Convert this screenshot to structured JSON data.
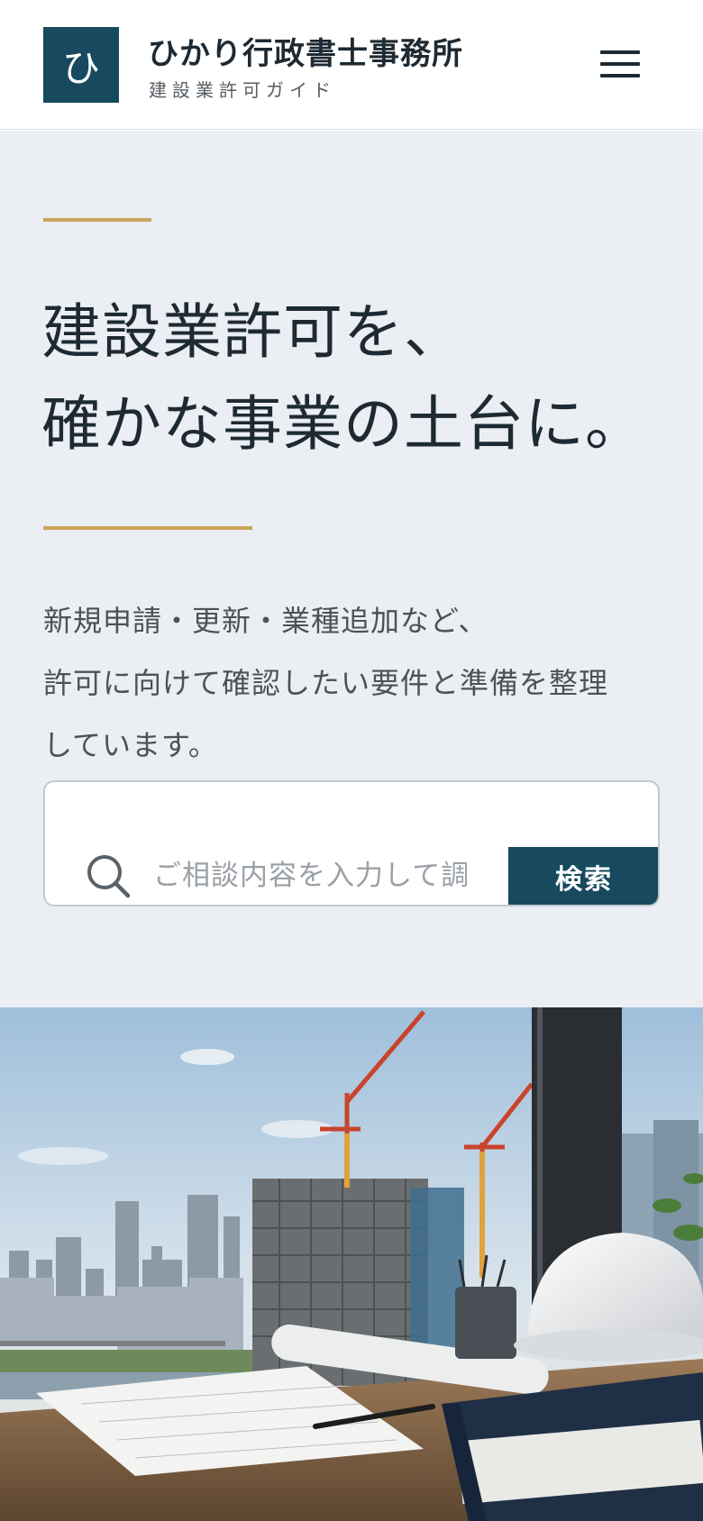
{
  "header": {
    "logo_char": "ひ",
    "brand_name": "ひかり行政書士事務所",
    "brand_sub": "建設業許可ガイド",
    "menu_icon": "hamburger-menu-icon"
  },
  "hero": {
    "headline_line1": "建設業許可を、",
    "headline_line2": "確かな事業の土台に。",
    "lead_line1": "新規申請・更新・業種追加など、",
    "lead_line2": "許可に向けて確認したい要件と準備を整理",
    "lead_line3": "しています。"
  },
  "search": {
    "placeholder": "ご相談内容を入力して調",
    "button_label": "検索",
    "icon": "search-icon"
  },
  "photo": {
    "subject": "construction-site-office-desk-image"
  },
  "colors": {
    "brand": "#174a5e",
    "gold": "#c9a45c",
    "hero_bg": "#ebeef2",
    "text": "#1e2a33"
  }
}
